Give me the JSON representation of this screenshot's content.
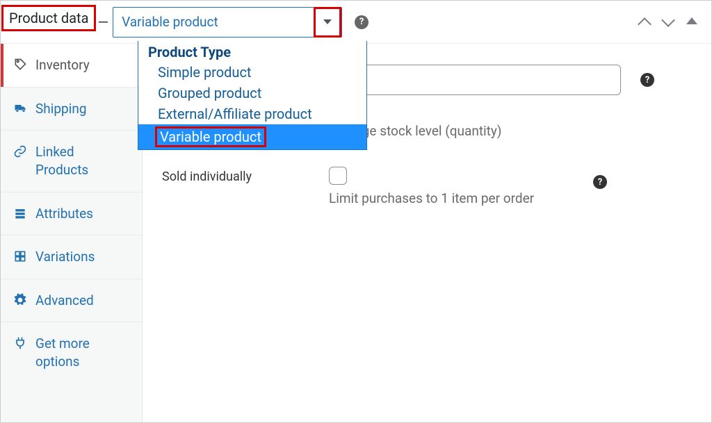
{
  "panel": {
    "title": "Product data",
    "dash": "—"
  },
  "productType": {
    "selected": "Variable product",
    "groupLabel": "Product Type",
    "options": [
      "Simple product",
      "Grouped product",
      "External/Affiliate product",
      "Variable product"
    ],
    "selectedIndex": 3
  },
  "tabs": [
    {
      "label": "Inventory",
      "active": true
    },
    {
      "label": "Shipping",
      "active": false
    },
    {
      "label": "Linked Products",
      "active": false
    },
    {
      "label": "Attributes",
      "active": false
    },
    {
      "label": "Variations",
      "active": false
    },
    {
      "label": "Advanced",
      "active": false
    },
    {
      "label": "Get more options",
      "active": false
    }
  ],
  "fields": {
    "sku": {
      "label": "",
      "value": ""
    },
    "manageStock": {
      "description": "Manage stock level (quantity)"
    },
    "soldIndividually": {
      "label": "Sold individually",
      "description": "Limit purchases to 1 item per order",
      "checked": false
    }
  },
  "help": "?"
}
